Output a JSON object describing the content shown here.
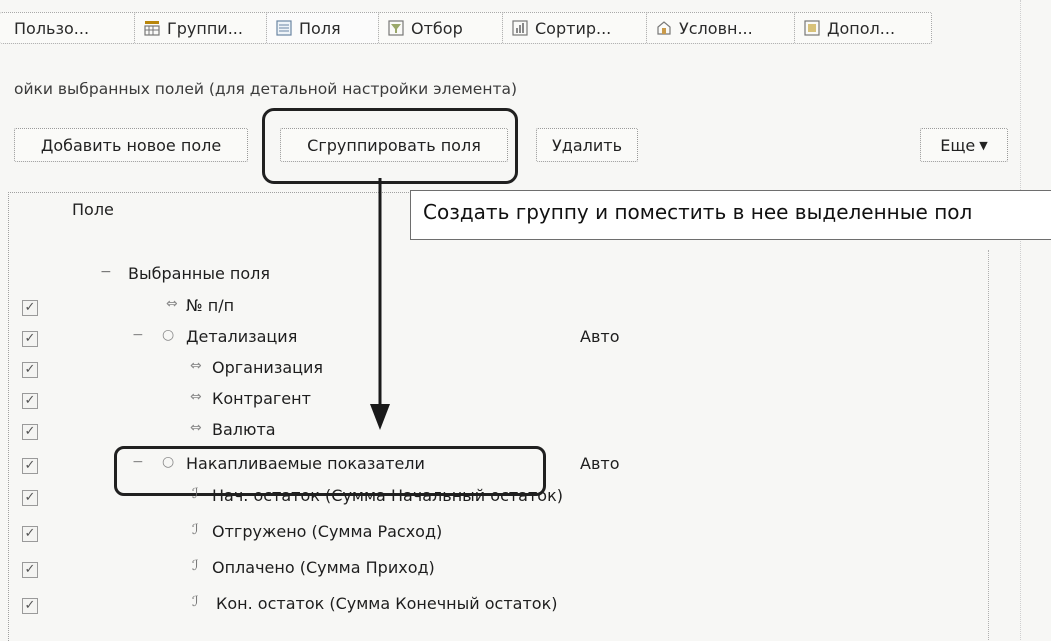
{
  "tabs": [
    {
      "label": "Пользо...",
      "icon": "user-settings-icon"
    },
    {
      "label": "Группи...",
      "icon": "grouping-icon"
    },
    {
      "label": "Поля",
      "icon": "fields-icon"
    },
    {
      "label": "Отбор",
      "icon": "filter-icon"
    },
    {
      "label": "Сортир...",
      "icon": "sort-icon"
    },
    {
      "label": "Условн...",
      "icon": "conditional-appearance-icon"
    },
    {
      "label": "Допол...",
      "icon": "additional-icon"
    }
  ],
  "hint": "ойки выбранных полей (для детальной настройки элемента)",
  "toolbar": {
    "add_label": "Добавить новое поле",
    "group_label": "Сгруппировать поля",
    "delete_label": "Удалить",
    "more_label": "Еще"
  },
  "tree": {
    "column_header": "Поле",
    "tooltip": "Создать группу и поместить в нее выделенные пол",
    "root_label": "Выбранные поля",
    "rows": [
      {
        "label": "№ п/п",
        "value": "",
        "checked": true,
        "icon": "field-icon"
      },
      {
        "label": "Детализация",
        "value": "Авто",
        "checked": true,
        "icon": "group-icon"
      },
      {
        "label": "Организация",
        "value": "",
        "checked": true,
        "icon": "field-icon"
      },
      {
        "label": "Контрагент",
        "value": "",
        "checked": true,
        "icon": "field-icon"
      },
      {
        "label": "Валюта",
        "value": "",
        "checked": true,
        "icon": "field-icon"
      },
      {
        "label": "Накапливаемые показатели",
        "value": "Авто",
        "checked": true,
        "icon": "group-icon"
      },
      {
        "label": "Нач. остаток (Сумма Начальный остаток)",
        "value": "",
        "checked": true,
        "icon": "resource-icon"
      },
      {
        "label": "Отгружено (Сумма Расход)",
        "value": "",
        "checked": true,
        "icon": "resource-icon"
      },
      {
        "label": "Оплачено (Сумма Приход)",
        "value": "",
        "checked": true,
        "icon": "resource-icon"
      },
      {
        "label": "Кон. остаток (Сумма Конечный остаток)",
        "value": "",
        "checked": true,
        "icon": "resource-icon"
      }
    ]
  }
}
